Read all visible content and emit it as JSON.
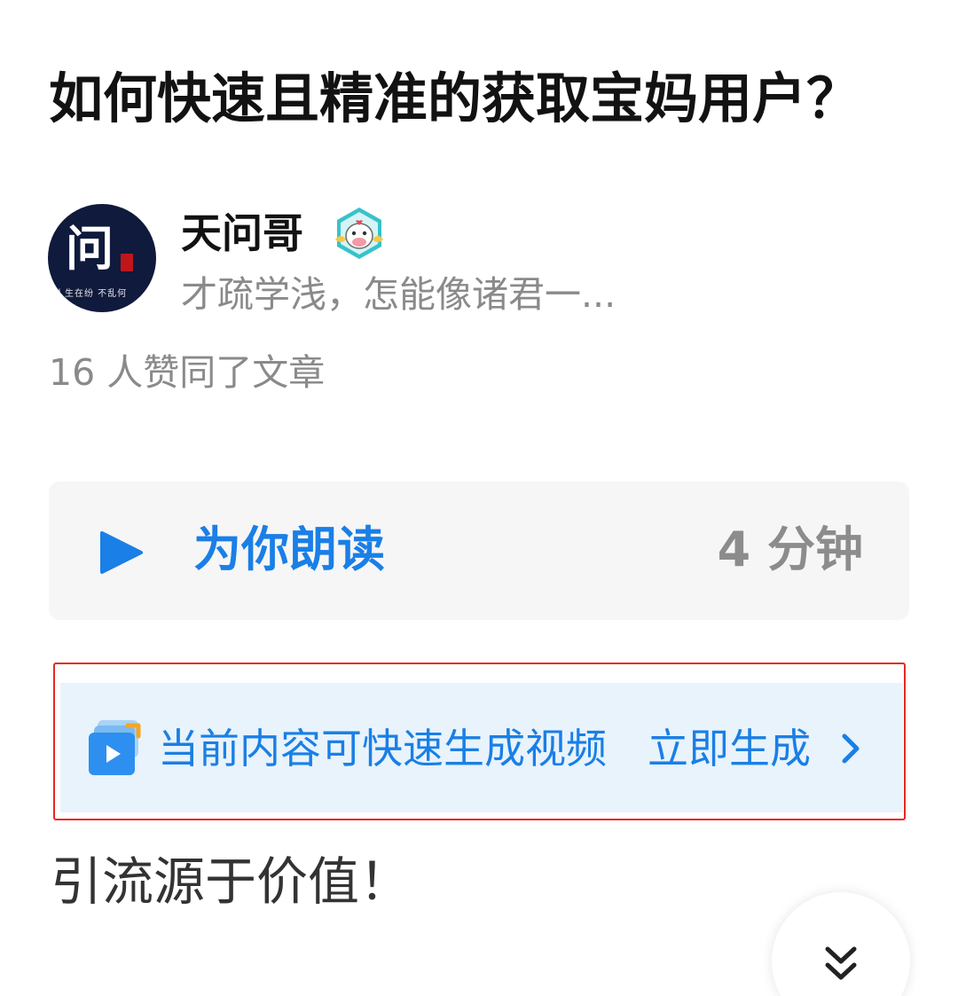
{
  "article": {
    "title": "如何快速且精准的获取宝妈用户？",
    "likes_text": "16 人赞同了文章",
    "body_first_line": "引流源于价值！"
  },
  "author": {
    "avatar_char": "问",
    "avatar_motto": "人生在纷 不乱何",
    "name": "天问哥",
    "bio": "才疏学浅，怎能像诸君一..."
  },
  "read_aloud": {
    "label": "为你朗读",
    "duration": "4 分钟"
  },
  "video_prompt": {
    "text": "当前内容可快速生成视频",
    "action": "立即生成"
  },
  "colors": {
    "accent": "#1a7fe6",
    "highlight_border": "#e8281f",
    "banner_bg": "#e8f3fc",
    "card_bg": "#f6f6f6"
  },
  "icons": {
    "verified": "cartoon-badge-icon",
    "play": "play-icon",
    "video": "video-generate-icon",
    "chevron": "chevron-right-icon",
    "scroll": "double-chevron-down-icon"
  }
}
